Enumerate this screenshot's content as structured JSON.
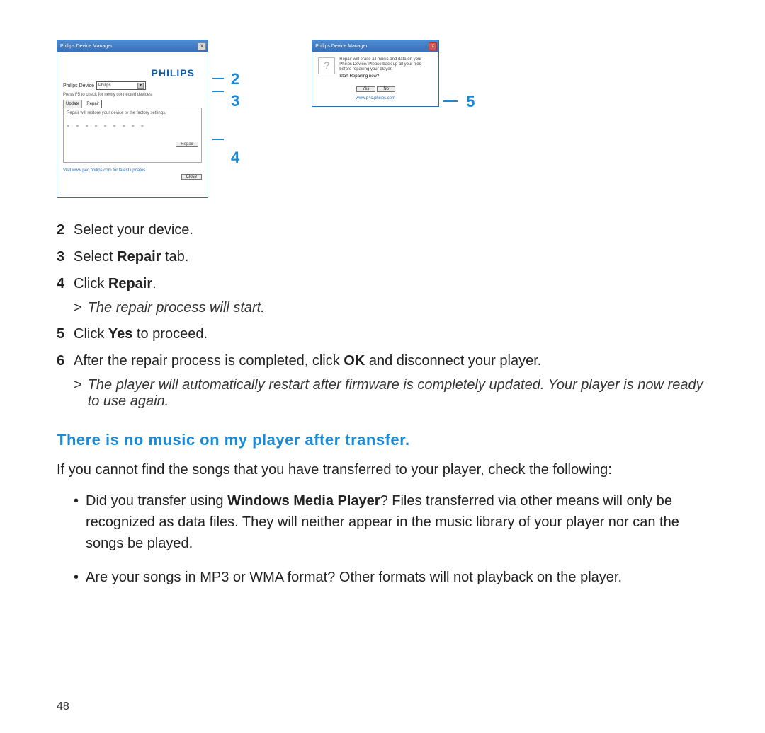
{
  "page_number": "48",
  "callouts": {
    "two": "2",
    "three": "3",
    "four": "4",
    "five": "5"
  },
  "win_a": {
    "title": "Philips Device Manager",
    "close": "x",
    "brand": "PHILIPS",
    "device_label": "Philips Device",
    "device_value": "Philips",
    "hint": "Press F5 to check for newly connected devices.",
    "tab_update": "Update",
    "tab_repair": "Repair",
    "tab_msg": "Repair will restore your device to the factory settings.",
    "repair_btn": "Repair",
    "link": "Visit www.p4c.philips.com for latest updates.",
    "close_btn": "Close"
  },
  "win_b": {
    "title": "Philips Device Manager",
    "close": "x",
    "msg": "Repair will erase all music and data on your Philips Device. Please back up all your files before repairing your player.",
    "question": "Start Repairing now?",
    "yes": "Yes",
    "no": "No",
    "link": "www.p4c.philips.com"
  },
  "steps": {
    "s2": {
      "num": "2",
      "text_a": "Select your device."
    },
    "s3": {
      "num": "3",
      "text_a": "Select ",
      "bold": "Repair",
      "text_b": " tab."
    },
    "s4": {
      "num": "4",
      "text_a": "Click ",
      "bold": "Repair",
      "text_b": "."
    },
    "sub4": "The repair process will start.",
    "s5": {
      "num": "5",
      "text_a": "Click ",
      "bold": "Yes",
      "text_b": " to proceed."
    },
    "s6": {
      "num": "6",
      "text_a": "After the repair process is completed, click ",
      "bold": "OK",
      "text_b": " and disconnect your player."
    },
    "sub6": "The player will automatically restart after firmware is completely updated. Your player is now ready to use again."
  },
  "section_heading": "There is no music on my player after transfer.",
  "para": "If you cannot find the songs that you have transferred to your player, check the following:",
  "bullets": {
    "b1": {
      "a": "Did you transfer using ",
      "bold": "Windows Media Player",
      "b": "? Files transferred via other means will only be recognized as data files. They will neither appear in the music library of your player nor can the songs be played."
    },
    "b2": "Are your songs in MP3 or WMA format? Other formats will not playback on the player."
  }
}
